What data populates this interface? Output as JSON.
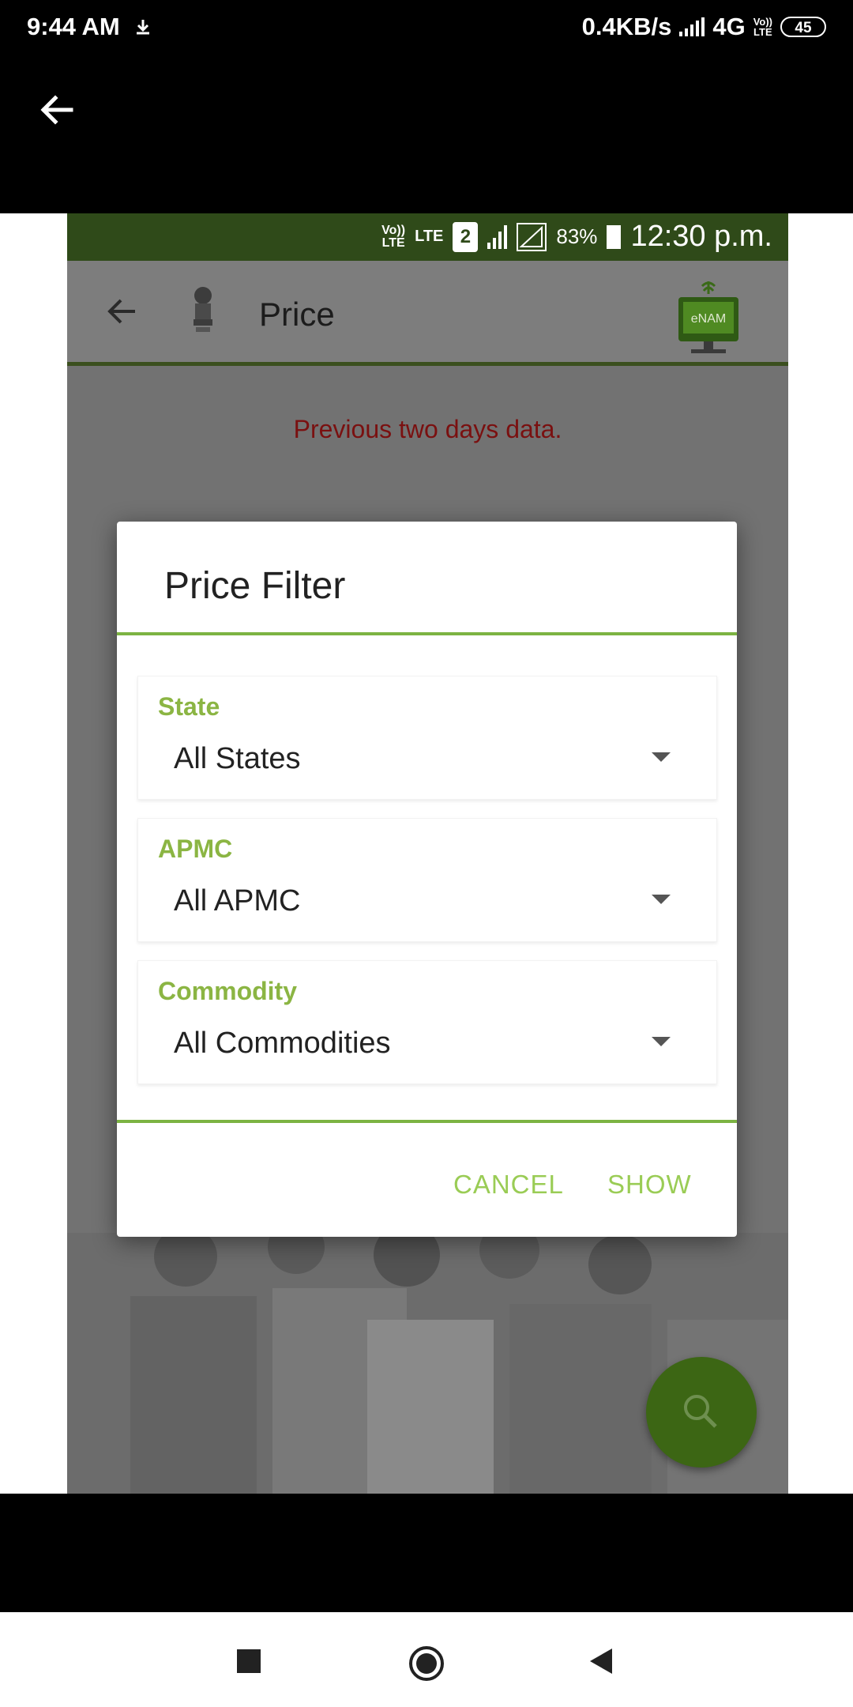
{
  "outer_status": {
    "time": "9:44 AM",
    "speed": "0.4KB/s",
    "network": "4G",
    "volte_top": "Vo))",
    "volte_bottom": "LTE",
    "battery": "45"
  },
  "inner_status": {
    "volte_top": "Vo))",
    "volte_bottom": "LTE",
    "lte": "LTE",
    "sim": "2",
    "battery_percent": "83%",
    "time": "12:30 p.m."
  },
  "inner_toolbar": {
    "title": "Price"
  },
  "notice": "Previous two days data.",
  "dialog": {
    "title": "Price Filter",
    "fields": [
      {
        "label": "State",
        "value": "All States"
      },
      {
        "label": "APMC",
        "value": "All APMC"
      },
      {
        "label": "Commodity",
        "value": "All Commodities"
      }
    ],
    "cancel_label": "CANCEL",
    "show_label": "SHOW"
  },
  "colors": {
    "accent_green": "#8bb543",
    "notice_red": "#7a1010",
    "inner_statusbar": "#2f4a19",
    "fab_green": "#3c6614"
  }
}
